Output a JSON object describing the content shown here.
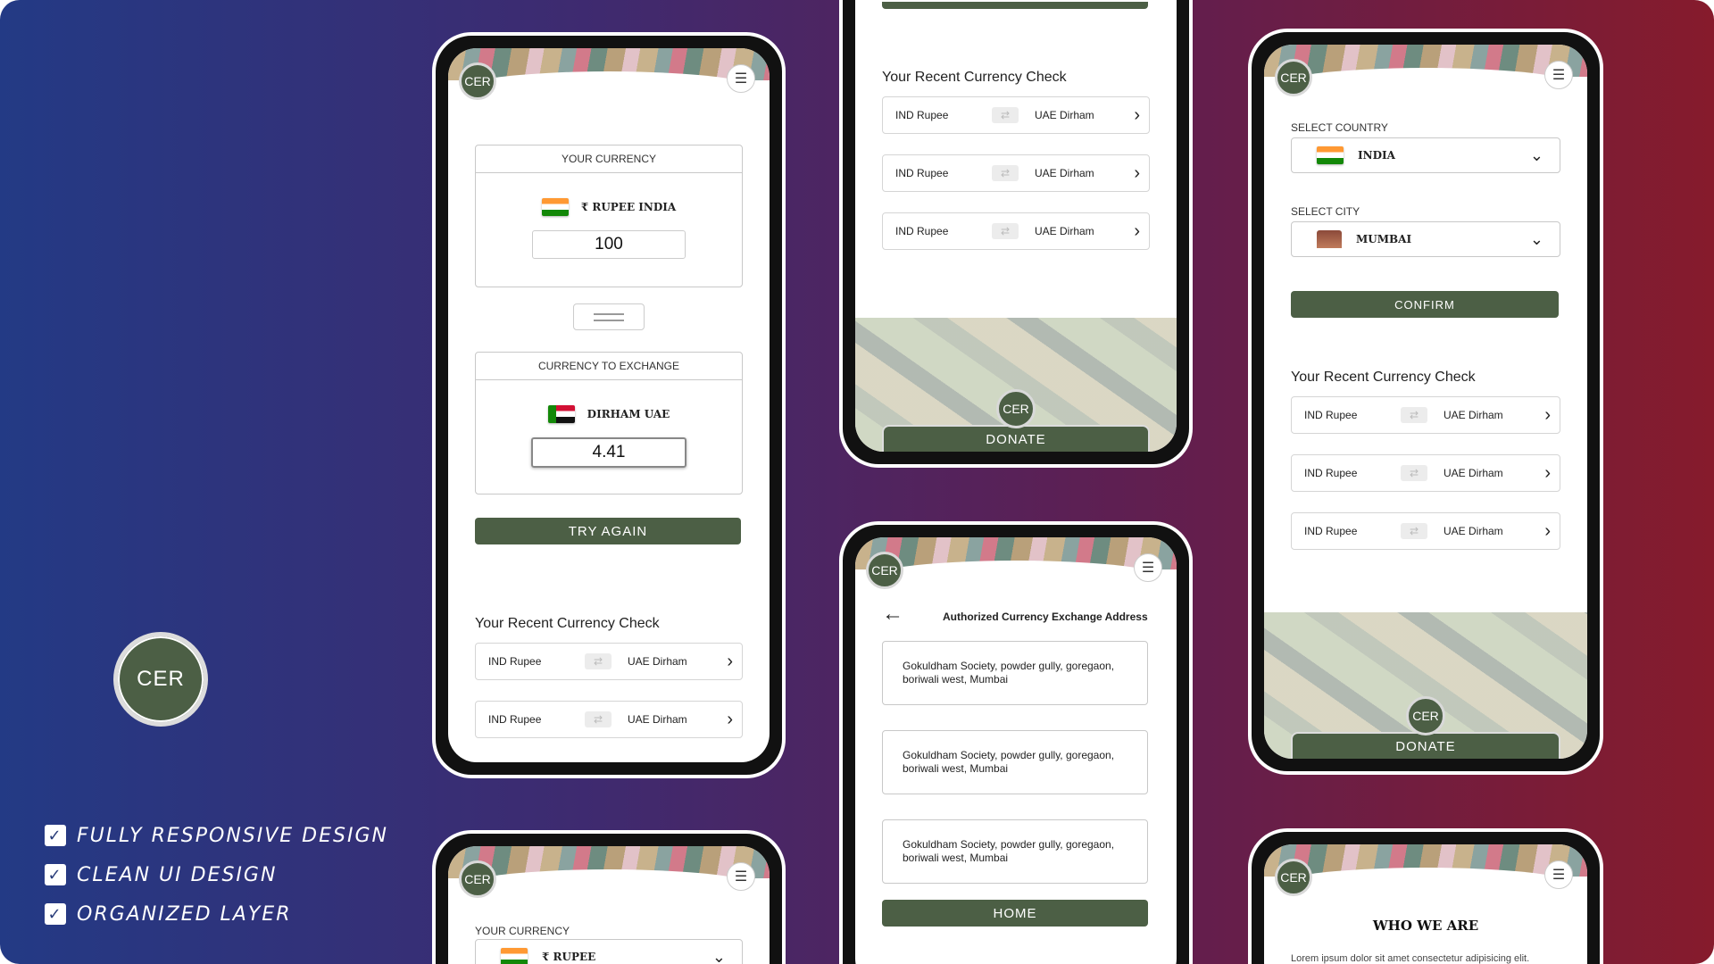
{
  "brand": "CER",
  "features": [
    "Fully Responsive Design",
    "Clean UI Design",
    "Organized Layer"
  ],
  "converter": {
    "your_currency_label": "YOUR CURRENCY",
    "your_currency_name": "₹ RUPEE INDIA",
    "your_amount": "100",
    "exchange_label": "CURRENCY TO EXCHANGE",
    "exchange_currency_name": "DIRHAM UAE",
    "exchange_amount": "4.41",
    "try_again": "TRY AGAIN"
  },
  "recent": {
    "title": "Your Recent Currency Check",
    "rows": [
      {
        "from": "IND Rupee",
        "to": "UAE Dirham"
      },
      {
        "from": "IND Rupee",
        "to": "UAE Dirham"
      },
      {
        "from": "IND Rupee",
        "to": "UAE Dirham"
      }
    ]
  },
  "donate_label": "DONATE",
  "address_screen": {
    "title": "Authorized Currency Exchange Address",
    "addresses": [
      "Gokuldham Society, powder gully, goregaon, boriwali west, Mumbai",
      "Gokuldham Society, powder gully, goregaon, boriwali west, Mumbai",
      "Gokuldham Society, powder gully, goregaon, boriwali west, Mumbai"
    ],
    "home": "HOME"
  },
  "location": {
    "country_label": "SELECT COUNTRY",
    "country": "INDIA",
    "city_label": "SELECT CITY",
    "city": "MUMBAI",
    "confirm": "CONFIRM"
  },
  "bottom_left": {
    "label": "YOUR CURRENCY",
    "value": "₹ RUPEE"
  },
  "who": {
    "title": "WHO WE ARE",
    "text": "Lorem ipsum dolor sit amet consectetur adipisicing elit. Cumque modi sit ad aperiam hic non nobis"
  },
  "colors": {
    "accent": "#4c5f45",
    "bg_left": "#233a85",
    "bg_right": "#861b2c"
  }
}
